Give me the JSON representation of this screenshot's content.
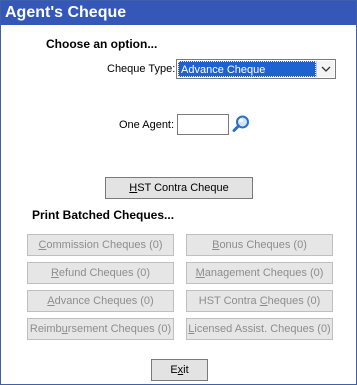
{
  "window": {
    "title": "Agent's Cheque"
  },
  "options": {
    "heading": "Choose an option...",
    "cheque_type_label": "Cheque Type:",
    "cheque_type_value": "Advance Cheque",
    "one_agent_label": "One Agent:",
    "one_agent_value": ""
  },
  "hst_contra": {
    "label_prefix": "",
    "label_accel": "H",
    "label_rest": "ST Contra Cheque"
  },
  "batched": {
    "heading": "Print Batched Cheques...",
    "commission": {
      "accel": "C",
      "rest": "ommission Cheques (0)"
    },
    "bonus": {
      "accel": "B",
      "rest": "onus Cheques (0)"
    },
    "refund": {
      "accel": "R",
      "rest": "efund Cheques (0)"
    },
    "management": {
      "accel": "M",
      "rest": "anagement Cheques (0)"
    },
    "advance": {
      "accel": "A",
      "rest": "dvance Cheques (0)"
    },
    "hst_contra": {
      "pre": "HST Contra ",
      "accel": "C",
      "rest": "heques (0)"
    },
    "reimbursement": {
      "pre": "Reimb",
      "accel": "u",
      "rest": "rsement Cheques (0)"
    },
    "licensed": {
      "pre": "",
      "accel": "L",
      "rest": "icensed Assist. Cheques (0)"
    }
  },
  "exit": {
    "pre": "E",
    "accel": "x",
    "rest": "it"
  },
  "colors": {
    "titlebar": "#3457b8",
    "selection": "#1e62d0"
  }
}
